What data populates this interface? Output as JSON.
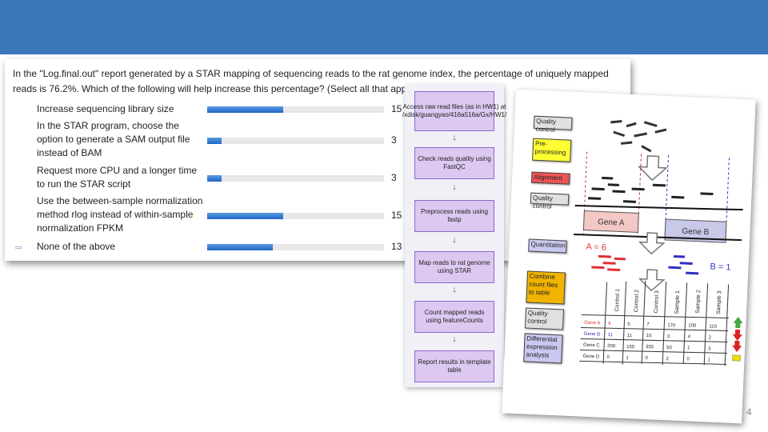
{
  "slide": {
    "page_number": "4"
  },
  "poll": {
    "question": "In the \"Log.final.out\" report generated by a STAR mapping of sequencing reads to the rat genome index, the percentage of uniquely mapped reads is 76.2%. Which of the following will help increase this percentage?  (Select all that apply)",
    "options": [
      {
        "text": "Increase sequencing library size",
        "count": "15",
        "fraction": 0.43
      },
      {
        "text": "In the STAR program, choose the option to generate a SAM output file instead of BAM",
        "count": "3",
        "fraction": 0.08
      },
      {
        "text": "Request more CPU and a longer time to run the STAR script",
        "count": "3",
        "fraction": 0.08
      },
      {
        "text": "Use the between-sample normalization method rlog instead of within-sample normalization FPKM",
        "count": "15",
        "fraction": 0.43
      },
      {
        "text": "None of the above",
        "count": "13",
        "fraction": 0.37,
        "arrow": "⇨"
      }
    ],
    "bar_color": "#2a6fcf"
  },
  "flowchart": {
    "steps": [
      "Access raw read files (as in HW1) at /xdisk/guangyao/416a516a/Gx/HW1/",
      "Check reads quality using FastQC",
      "Preprocess reads using fastp",
      "Map reads to rat genome using STAR",
      "Count mapped reads using featureCounts",
      "Report results in template table"
    ],
    "arrow": "↓",
    "box_color": "#dcc8f0"
  },
  "diagram": {
    "labels": [
      {
        "text": "Quality control",
        "color": "#e0e0e0"
      },
      {
        "text": "Pre-processing",
        "color": "#ffff33"
      },
      {
        "text": "Alignment",
        "color": "#ee5555"
      },
      {
        "text": "Quality control",
        "color": "#e0e0e0"
      },
      {
        "text": "Quantitation",
        "color": "#c8c8f0"
      },
      {
        "text": "Combine count files to table",
        "color": "#f0b400"
      },
      {
        "text": "Quality control",
        "color": "#e0e0e0"
      },
      {
        "text": "Differential expression analysis",
        "color": "#c8c8f0"
      }
    ],
    "gene_a": "Gene A",
    "gene_b": "Gene B",
    "count_a": "A = 6",
    "count_b": "B = 1",
    "table": {
      "columns": [
        "Control 1",
        "Control 2",
        "Control 3",
        "Sample 1",
        "Sample 2",
        "Sample 3"
      ],
      "rows": [
        {
          "gene": "Gene A",
          "values": [
            "6",
            "5",
            "7",
            "170",
            "100",
            "110"
          ]
        },
        {
          "gene": "Gene B",
          "values": [
            "11",
            "11",
            "10",
            "3",
            "4",
            "2"
          ]
        },
        {
          "gene": "Gene C",
          "values": [
            "200",
            "150",
            "355",
            "50",
            "1",
            "3"
          ]
        },
        {
          "gene": "Gene D",
          "values": [
            "0",
            "1",
            "0",
            "2",
            "0",
            "1"
          ]
        }
      ]
    }
  }
}
